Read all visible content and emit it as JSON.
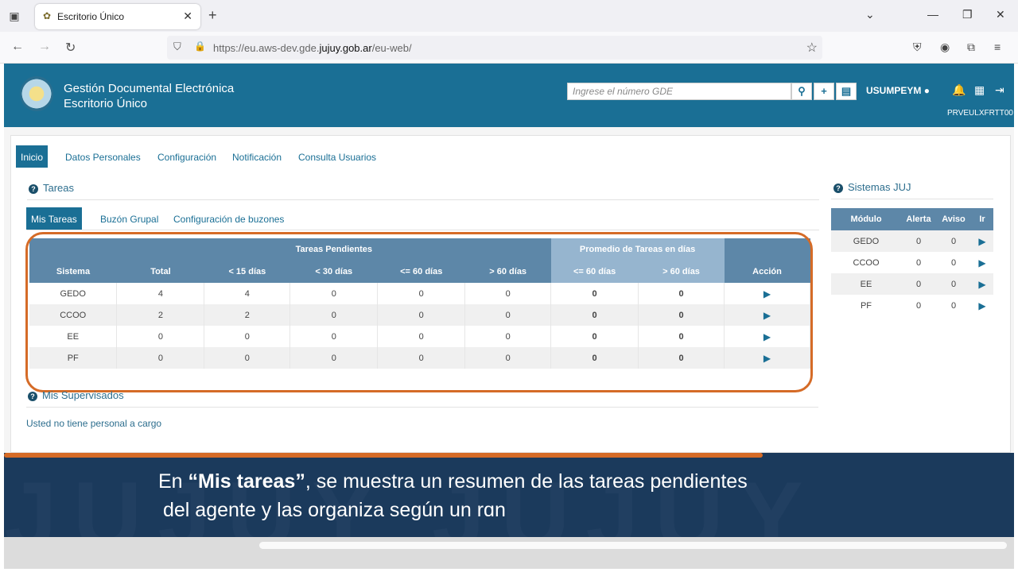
{
  "browser": {
    "tab_title": "Escritorio Único",
    "url_host_prefix": "https://eu.aws-dev.gde.",
    "url_domain": "jujuy.gob.ar",
    "url_path": "/eu-web/"
  },
  "app": {
    "title_line1": "Gestión Documental Electrónica",
    "title_line2": "Escritorio Único",
    "search_placeholder": "Ingrese el número GDE",
    "username": "USUMPEYM",
    "user_code": "PRVEULXFRTT00"
  },
  "main_tabs": [
    "Inicio",
    "Datos Personales",
    "Configuración",
    "Notificación",
    "Consulta Usuarios"
  ],
  "tareas": {
    "heading": "Tareas",
    "subtabs": [
      "Mis Tareas",
      "Buzón Grupal",
      "Configuración de buzones"
    ],
    "group_pendientes": "Tareas Pendientes",
    "group_promedio": "Promedio de Tareas en días",
    "columns": [
      "Sistema",
      "Total",
      "< 15 días",
      "< 30 días",
      "<= 60 días",
      "> 60 días",
      "<= 60 días",
      "> 60 días",
      "Acción"
    ],
    "rows": [
      {
        "sistema": "GEDO",
        "total": "4",
        "d15": "4",
        "d30": "0",
        "d60": "0",
        "g60": "0",
        "p60": "0",
        "pg60": "0"
      },
      {
        "sistema": "CCOO",
        "total": "2",
        "d15": "2",
        "d30": "0",
        "d60": "0",
        "g60": "0",
        "p60": "0",
        "pg60": "0"
      },
      {
        "sistema": "EE",
        "total": "0",
        "d15": "0",
        "d30": "0",
        "d60": "0",
        "g60": "0",
        "p60": "0",
        "pg60": "0"
      },
      {
        "sistema": "PF",
        "total": "0",
        "d15": "0",
        "d30": "0",
        "d60": "0",
        "g60": "0",
        "p60": "0",
        "pg60": "0"
      }
    ]
  },
  "supervisados": {
    "heading": "Mis Supervisados",
    "message": "Usted no tiene personal a cargo"
  },
  "sistemas": {
    "heading": "Sistemas JUJ",
    "columns": [
      "Módulo",
      "Alerta",
      "Aviso",
      "Ir"
    ],
    "rows": [
      {
        "modulo": "GEDO",
        "alerta": "0",
        "aviso": "0"
      },
      {
        "modulo": "CCOO",
        "alerta": "0",
        "aviso": "0"
      },
      {
        "modulo": "EE",
        "alerta": "0",
        "aviso": "0"
      },
      {
        "modulo": "PF",
        "alerta": "0",
        "aviso": "0"
      }
    ]
  },
  "caption": {
    "prefix": "En ",
    "highlight": "“Mis tareas”",
    "rest_line1": ", se muestra un resumen de las tareas pendientes",
    "line2": "del agente y las organiza según un rɑn"
  },
  "colors": {
    "header_blue": "#1a6f95",
    "accent_orange": "#d56b27",
    "caption_navy": "#1b3a5c"
  }
}
